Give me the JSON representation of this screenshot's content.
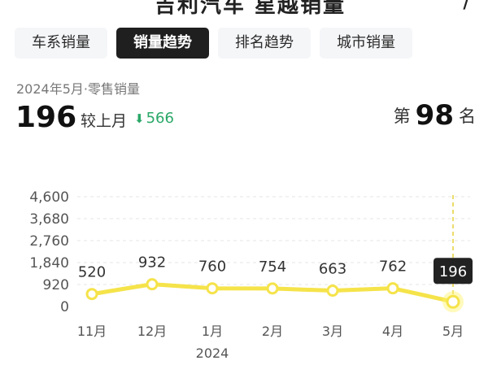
{
  "header": {
    "title_cut": "吉利汽车  星越销量",
    "chevron": "⟩"
  },
  "tabs": [
    {
      "label": "车系销量",
      "active": false
    },
    {
      "label": "销量趋势",
      "active": true
    },
    {
      "label": "排名趋势",
      "active": false
    },
    {
      "label": "城市销量",
      "active": false
    }
  ],
  "summary": {
    "period": "2024年5月·零售销量",
    "value": "196",
    "compare_label": "较上月",
    "delta": "566",
    "rank_prefix": "第",
    "rank": "98",
    "rank_suffix": "名"
  },
  "colors": {
    "line": "#f5e34a",
    "marker_fill": "#ffffff",
    "active_marker": "#fff36b",
    "tooltip_bg": "#222222",
    "grid": "#e6e6e6",
    "guide": "#e6d23c",
    "delta_down": "#2aa868"
  },
  "chart_data": {
    "type": "line",
    "categories": [
      "11月",
      "12月",
      "1月",
      "2月",
      "3月",
      "4月",
      "5月"
    ],
    "values": [
      520,
      932,
      760,
      754,
      663,
      762,
      196
    ],
    "data_labels": [
      "520",
      "932",
      "760",
      "754",
      "663",
      "762",
      "196"
    ],
    "highlight_index": 6,
    "year_label": "2024",
    "year_label_index": 2,
    "yticks": [
      0,
      920,
      1840,
      2760,
      3680,
      4600
    ],
    "ytick_labels": [
      "0",
      "920",
      "1,840",
      "2,760",
      "3,680",
      "4,600"
    ],
    "ylim": [
      0,
      4600
    ],
    "grid": true,
    "xlabel": "",
    "ylabel": ""
  }
}
